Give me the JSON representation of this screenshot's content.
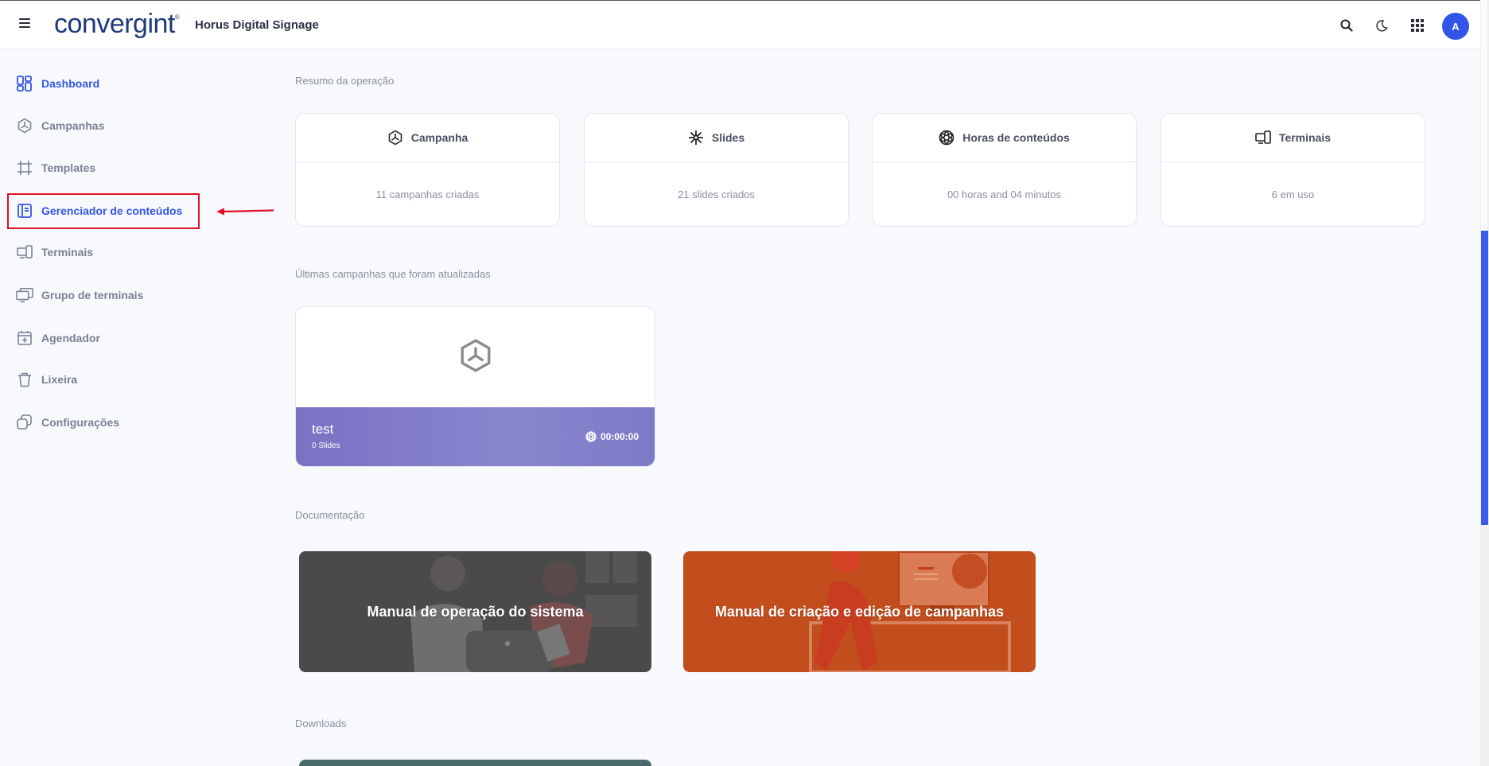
{
  "header": {
    "logo_text": "convergint",
    "app_title": "Horus Digital Signage",
    "avatar_initial": "A",
    "icons": [
      "menu-icon",
      "search-icon",
      "moon-icon",
      "apps-grid-icon"
    ]
  },
  "sidebar": {
    "items": [
      {
        "label": "Dashboard",
        "icon": "dashboard-icon",
        "active": true
      },
      {
        "label": "Campanhas",
        "icon": "campaign-icon"
      },
      {
        "label": "Templates",
        "icon": "crop-icon"
      },
      {
        "label": "Gerenciador de conteúdos",
        "icon": "content-manager-icon",
        "active": true
      },
      {
        "label": "Terminais",
        "icon": "devices-icon"
      },
      {
        "label": "Grupo de terminais",
        "icon": "monitors-icon"
      },
      {
        "label": "Agendador",
        "icon": "calendar-icon"
      },
      {
        "label": "Lixeira",
        "icon": "trash-icon"
      },
      {
        "label": "Configurações",
        "icon": "settings-icon"
      }
    ]
  },
  "summary": {
    "label": "Resumo da operação",
    "cards": [
      {
        "title": "Campanha",
        "value": "11 campanhas criadas",
        "icon": "campaign-icon"
      },
      {
        "title": "Slides",
        "value": "21 slides criados",
        "icon": "sparkle-icon"
      },
      {
        "title": "Horas de conteúdos",
        "value": "00 horas and 04 minutos",
        "icon": "film-reel-icon"
      },
      {
        "title": "Terminais",
        "value": "6 em uso",
        "icon": "devices-icon"
      }
    ]
  },
  "recent": {
    "label": "Últimas campanhas que foram atualizadas",
    "campaign": {
      "name": "test",
      "slides": "0 Slides",
      "duration": "00:00:00"
    }
  },
  "docs": {
    "label": "Documentação",
    "cards": [
      {
        "title": "Manual de operação do sistema",
        "color": "#4a4a4a"
      },
      {
        "title": "Manual de criação e edição de campanhas",
        "color": "#c24e1e"
      }
    ]
  },
  "downloads": {
    "label": "Downloads"
  },
  "colors": {
    "accent": "#3354e8",
    "highlight": "#e0102a"
  }
}
